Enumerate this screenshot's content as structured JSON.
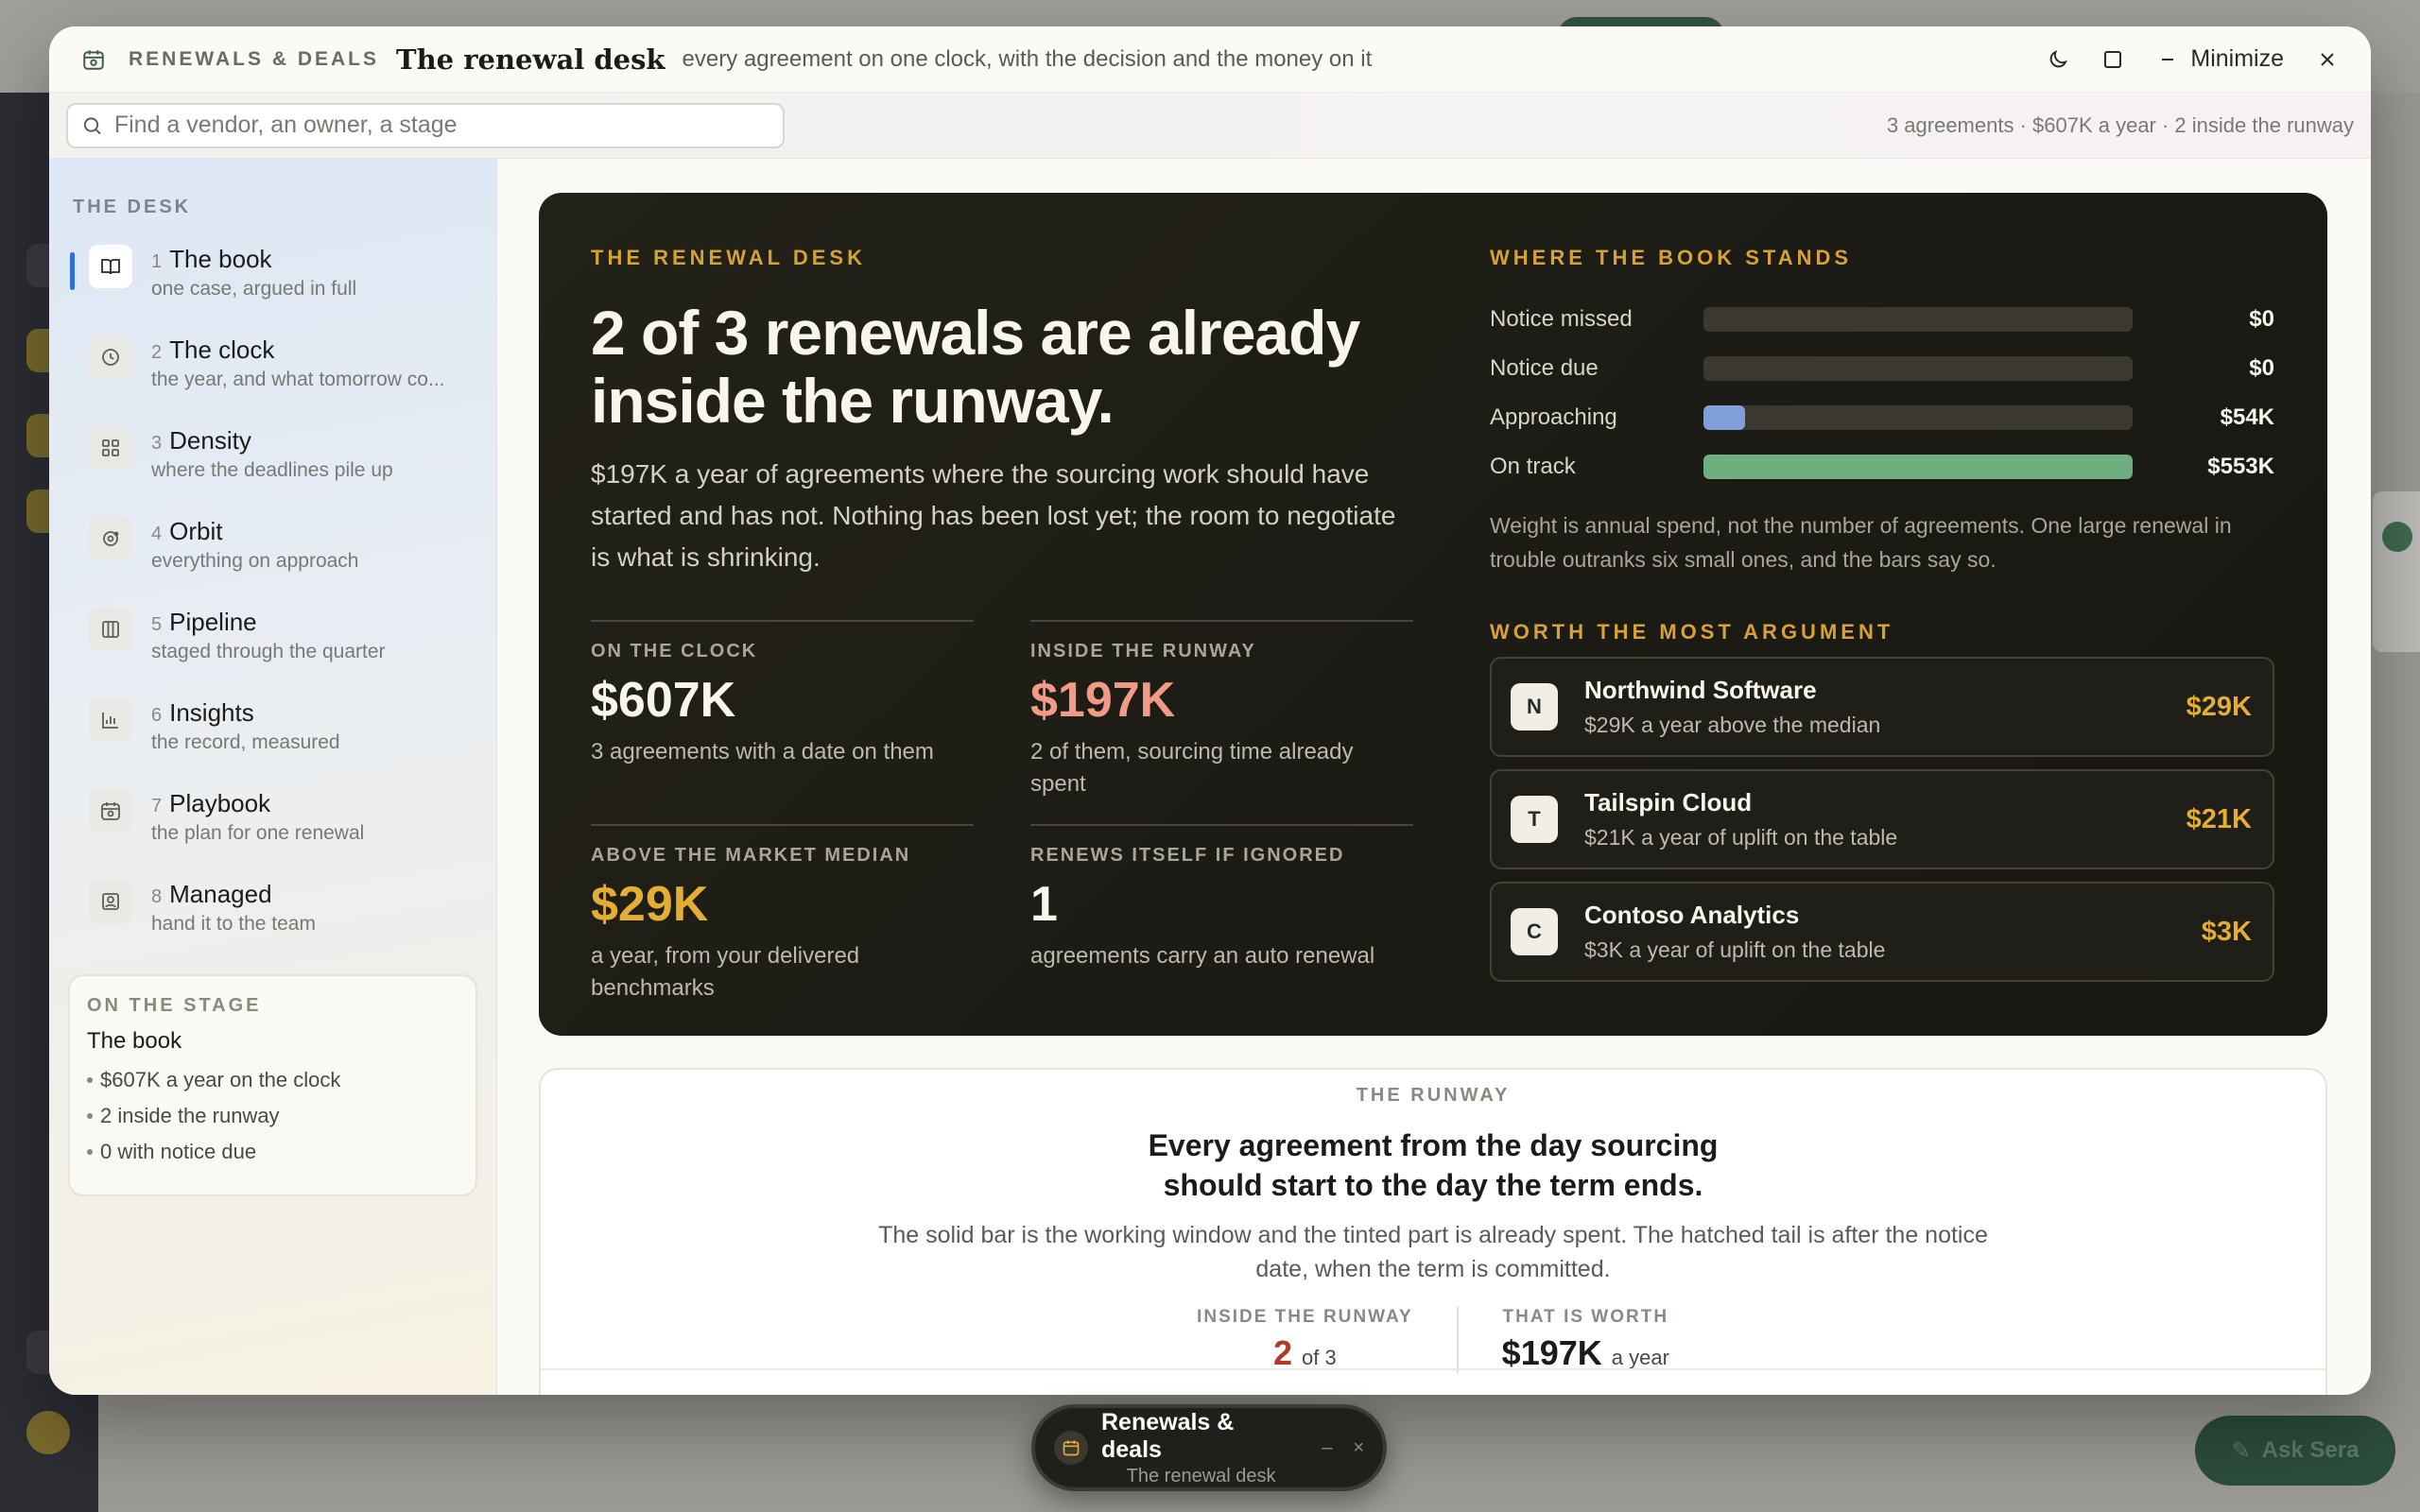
{
  "titlebar": {
    "kicker": "RENEWALS & DEALS",
    "title": "The renewal desk",
    "subtitle": "every agreement on one clock, with the decision and the money on it",
    "minimize_label": "Minimize"
  },
  "search": {
    "placeholder": "Find a vendor, an owner, a stage",
    "stats": "3 agreements · $607K a year · 2 inside the runway"
  },
  "sidebar": {
    "heading": "THE DESK",
    "items": [
      {
        "num": "1",
        "label": "The book",
        "sub": "one case, argued in full",
        "icon": "book-icon"
      },
      {
        "num": "2",
        "label": "The clock",
        "sub": "the year, and what tomorrow co...",
        "icon": "clock-icon"
      },
      {
        "num": "3",
        "label": "Density",
        "sub": "where the deadlines pile up",
        "icon": "grid-icon"
      },
      {
        "num": "4",
        "label": "Orbit",
        "sub": "everything on approach",
        "icon": "orbit-icon"
      },
      {
        "num": "5",
        "label": "Pipeline",
        "sub": "staged through the quarter",
        "icon": "columns-icon"
      },
      {
        "num": "6",
        "label": "Insights",
        "sub": "the record, measured",
        "icon": "bar-chart-icon"
      },
      {
        "num": "7",
        "label": "Playbook",
        "sub": "the plan for one renewal",
        "icon": "calendar-icon"
      },
      {
        "num": "8",
        "label": "Managed",
        "sub": "hand it to the team",
        "icon": "person-badge-icon"
      }
    ],
    "stage": {
      "kicker": "ON THE STAGE",
      "title": "The book",
      "points": [
        "$607K a year on the clock",
        "2 inside the runway",
        "0 with notice due"
      ]
    }
  },
  "hero": {
    "kicker": "THE RENEWAL DESK",
    "headline": "2 of 3 renewals are already inside the runway.",
    "lede": "$197K a year of agreements where the sourcing work should have started and has not. Nothing has been lost yet; the room to negotiate is what is shrinking.",
    "stats": [
      {
        "label": "ON THE CLOCK",
        "value": "$607K",
        "desc": "3 agreements with a date on them"
      },
      {
        "label": "INSIDE THE RUNWAY",
        "value": "$197K",
        "desc": "2 of them, sourcing time already spent"
      },
      {
        "label": "ABOVE THE MARKET MEDIAN",
        "value": "$29K",
        "desc": "a year, from your delivered benchmarks"
      },
      {
        "label": "RENEWS ITSELF IF IGNORED",
        "value": "1",
        "desc": "agreements carry an auto renewal"
      }
    ],
    "book_heading": "WHERE THE BOOK STANDS",
    "bars": [
      {
        "label": "Notice missed",
        "value": "$0",
        "amount": 0,
        "color": "#c2564a"
      },
      {
        "label": "Notice due",
        "value": "$0",
        "amount": 0,
        "color": "#d6a233"
      },
      {
        "label": "Approaching",
        "value": "$54K",
        "amount": 54,
        "color": "#7f9fd6"
      },
      {
        "label": "On track",
        "value": "$553K",
        "amount": 553,
        "color": "#6fae7f"
      }
    ],
    "note": "Weight is annual spend, not the number of agreements. One large renewal in trouble outranks six small ones, and the bars say so.",
    "argue_heading": "WORTH THE MOST ARGUMENT",
    "deals": [
      {
        "badge": "N",
        "name": "Northwind Software",
        "sub": "$29K a year above the median",
        "value": "$29K"
      },
      {
        "badge": "T",
        "name": "Tailspin Cloud",
        "sub": "$21K a year of uplift on the table",
        "value": "$21K"
      },
      {
        "badge": "C",
        "name": "Contoso Analytics",
        "sub": "$3K a year of uplift on the table",
        "value": "$3K"
      }
    ]
  },
  "runway": {
    "kicker": "THE RUNWAY",
    "headline": "Every agreement from the day sourcing should start to the day the term ends.",
    "text": "The solid bar is the working window and the tinted part is already spent. The hatched tail is after the notice date, when the term is committed.",
    "inside_label": "INSIDE THE RUNWAY",
    "inside_value": "2",
    "inside_of": "of 3",
    "worth_label": "THAT IS WORTH",
    "worth_value": "$197K",
    "worth_unit": "a year"
  },
  "dock": {
    "title": "Renewals & deals",
    "subtitle": "The renewal desk",
    "minimize": "–",
    "close": "×"
  },
  "backdrop": {
    "ask_label": "Ask Sera"
  }
}
